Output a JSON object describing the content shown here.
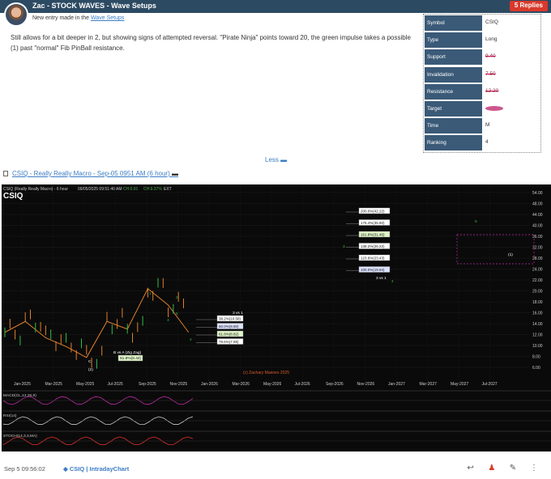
{
  "post": {
    "author_title": "Zac - STOCK WAVES - Wave Setups",
    "replies_label": "5 Replies",
    "entry_prefix": "New entry made in the",
    "entry_link": "Wave Setups",
    "body": "Still allows for a bit deeper in 2, but showing signs of attempted reversal. \"Pirate Ninja\" points toward 20, the green impulse takes a possible (1) past \"normal\" Fib PinBall resistance.",
    "less_label": "Less",
    "chart_link": "CSIQ - Really Really Macro - Sep-05 0951 AM (6 hour)",
    "timestamp": "Sep 5 09:56:02",
    "tag_symbol": "CSIQ",
    "tag_chart": "IntradayChart"
  },
  "setup_table": [
    {
      "key": "Symbol",
      "value": "CSIQ",
      "struck": false
    },
    {
      "key": "Type",
      "value": "Long",
      "struck": false
    },
    {
      "key": "Support",
      "value": "9.40",
      "struck": true
    },
    {
      "key": "Invalidation",
      "value": "7.50",
      "struck": true
    },
    {
      "key": "Resistance",
      "value": "12.20",
      "struck": true
    },
    {
      "key": "Target",
      "value": "",
      "struck": true,
      "scribbled": true
    },
    {
      "key": "Time",
      "value": "M",
      "struck": false
    },
    {
      "key": "Ranking",
      "value": "4",
      "struck": false
    }
  ],
  "chart_data": {
    "type": "line",
    "title": "CSIQ",
    "subtitle": "CSIQ (Really Really Macro) - 6 hour",
    "header_date": "09/05/2025 09:51:40 AM",
    "header_vals": [
      "CH:0.91",
      "CH:9.37%",
      "EXT"
    ],
    "watermark": "(c) Zachary Mannes 2025",
    "y_ticks": [
      "54.00",
      "48.00",
      "44.00",
      "40.00",
      "36.00",
      "32.00",
      "28.00",
      "24.00",
      "22.00",
      "20.00",
      "18.00",
      "16.00",
      "14.00",
      "12.00",
      "10.00",
      "8.00",
      "6.00"
    ],
    "x_ticks": [
      "Jan-2025",
      "Mar-2025",
      "May-2025",
      "Jul-2025",
      "Sep-2025",
      "Nov-2025",
      "Jan-2026",
      "Mar-2026",
      "May-2026",
      "Jul-2026",
      "Sep-2026",
      "Nov-2026",
      "Jan-2027",
      "Mar-2027",
      "May-2027",
      "Jul-2027"
    ],
    "price_x": [
      0,
      4,
      8,
      12,
      16,
      20,
      24,
      28,
      32,
      36
    ],
    "price_y": [
      9.5,
      10.5,
      9.0,
      8.2,
      7.2,
      10.5,
      9.8,
      13.5,
      12.0,
      9.5
    ],
    "fib_upper": [
      "200.0%(42.22)",
      "176.4%(35.60)",
      "161.8%(31.46)",
      "138.2%(26.22)",
      "123.6%(23.43)",
      "100.0%(19.94)"
    ],
    "fib_lower": [
      "38.2%(10.58)",
      "50.0%(9.80)",
      "61.8%(8.82)",
      "78.6%(7.98)"
    ],
    "labels": [
      "3 vs 1",
      "3 vs 1",
      "B vs A (Zig Zag)",
      "61.8%(8.44)",
      "(1)",
      "5",
      "3",
      "4",
      "1",
      "2",
      "5",
      "3",
      "2",
      "C",
      "(2)"
    ],
    "panels": [
      "MACD(CL,12,26,9)",
      "RSI(14)",
      "STOCH(14,3,3,MA)"
    ]
  }
}
